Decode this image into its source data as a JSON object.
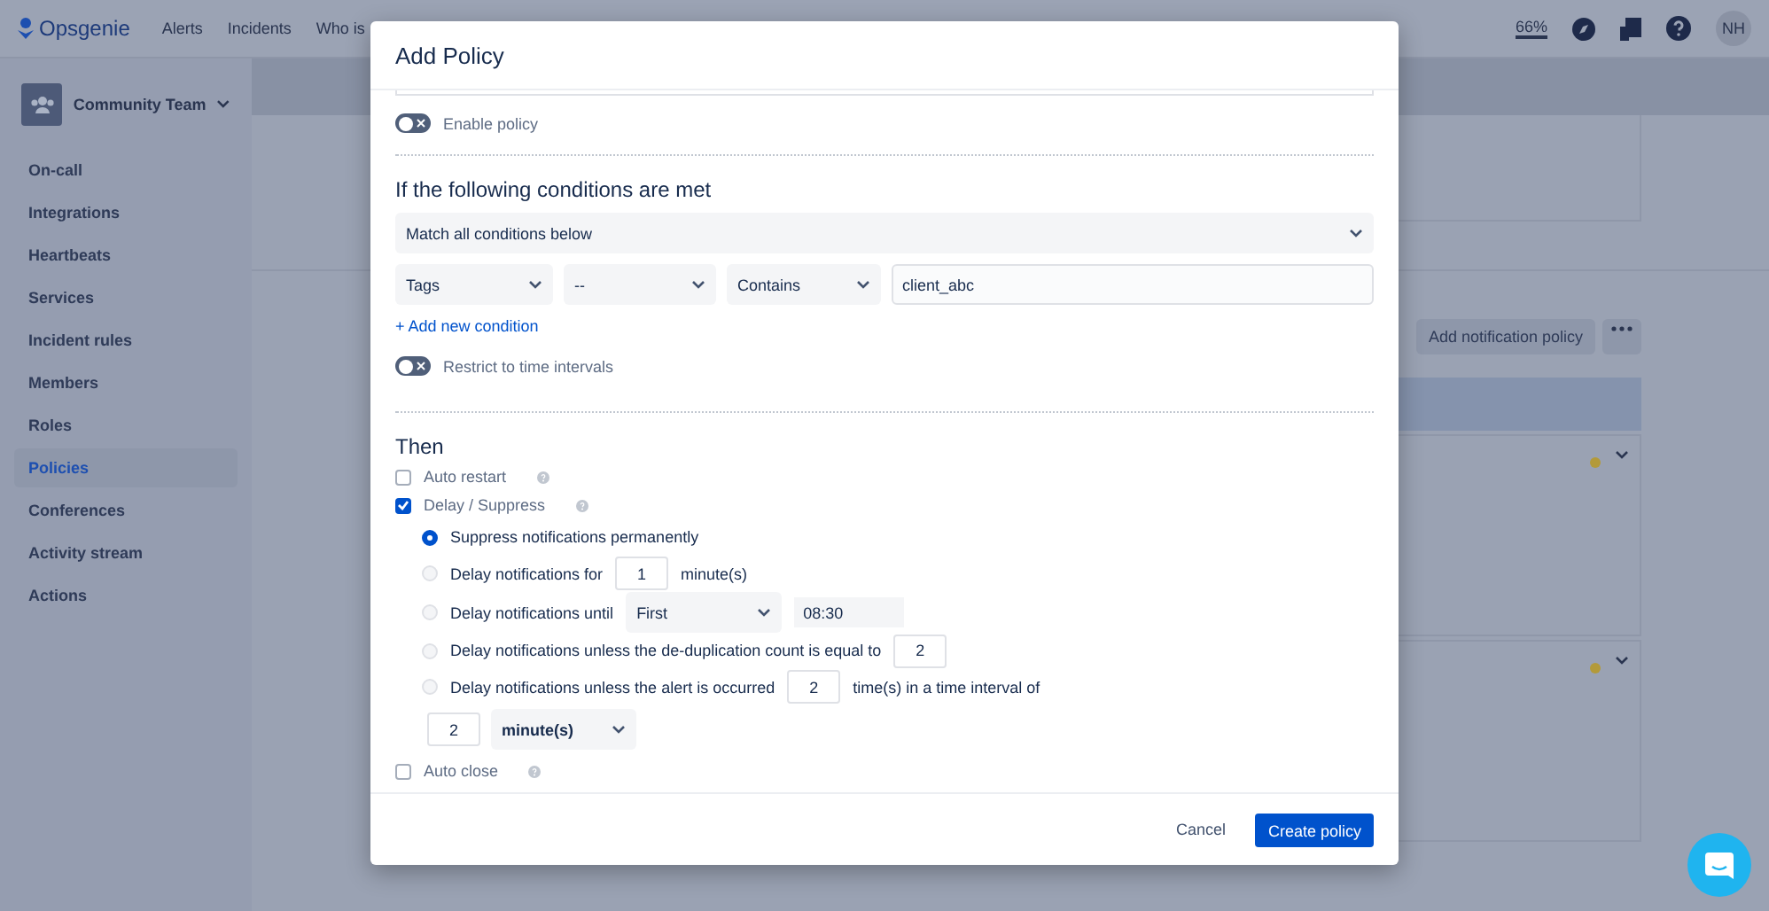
{
  "topbar": {
    "logo": "Opsgenie",
    "nav": [
      "Alerts",
      "Incidents",
      "Who is"
    ],
    "usage": "66%",
    "avatar": "NH"
  },
  "sidebar": {
    "team": "Community Team",
    "items": [
      {
        "label": "On-call",
        "selected": false
      },
      {
        "label": "Integrations",
        "selected": false
      },
      {
        "label": "Heartbeats",
        "selected": false
      },
      {
        "label": "Services",
        "selected": false
      },
      {
        "label": "Incident rules",
        "selected": false
      },
      {
        "label": "Members",
        "selected": false
      },
      {
        "label": "Roles",
        "selected": false
      },
      {
        "label": "Policies",
        "selected": true
      },
      {
        "label": "Conferences",
        "selected": false
      },
      {
        "label": "Activity stream",
        "selected": false
      },
      {
        "label": "Actions",
        "selected": false
      }
    ]
  },
  "background": {
    "add_button": "Add notification policy",
    "policies": [
      {
        "color": "#b39a3a"
      },
      {
        "color": "#b39a3a"
      }
    ]
  },
  "modal": {
    "title": "Add Policy",
    "enable_policy": {
      "label": "Enable policy",
      "on": false
    },
    "conditions_heading": "If the following conditions are met",
    "match": "Match all conditions below",
    "conditions": [
      {
        "field": "Tags",
        "key": "--",
        "operator": "Contains",
        "value": "client_abc"
      }
    ],
    "add_condition": "+ Add new condition",
    "restrict": {
      "label": "Restrict to time intervals",
      "on": false
    },
    "then_heading": "Then",
    "actions": [
      {
        "label": "Auto restart",
        "checked": false
      },
      {
        "label": "Delay / Suppress",
        "checked": true,
        "options": [
          {
            "selected": true,
            "parts": [
              {
                "kind": "text",
                "text": "Suppress notifications permanently"
              }
            ]
          },
          {
            "selected": false,
            "parts": [
              {
                "kind": "text",
                "text": "Delay notifications for"
              },
              {
                "kind": "number",
                "value": "1"
              },
              {
                "kind": "text",
                "text": "minute(s)"
              }
            ]
          },
          {
            "selected": false,
            "parts": [
              {
                "kind": "text",
                "text": "Delay notifications until"
              },
              {
                "kind": "select",
                "value": "First"
              },
              {
                "kind": "time",
                "value": "08:30"
              }
            ]
          },
          {
            "selected": false,
            "parts": [
              {
                "kind": "text",
                "text": "Delay notifications unless the de-duplication count is equal to"
              },
              {
                "kind": "number",
                "value": "2"
              }
            ]
          },
          {
            "selected": false,
            "parts": [
              {
                "kind": "text",
                "text": "Delay notifications unless the alert is occurred"
              },
              {
                "kind": "number",
                "value": "2"
              },
              {
                "kind": "text",
                "text": "time(s) in a time interval of"
              }
            ],
            "second_line": [
              {
                "kind": "number",
                "value": "2"
              },
              {
                "kind": "unit",
                "value": "minute(s)"
              }
            ]
          }
        ]
      },
      {
        "label": "Auto close",
        "checked": false
      }
    ],
    "cancel": "Cancel",
    "submit": "Create policy"
  }
}
